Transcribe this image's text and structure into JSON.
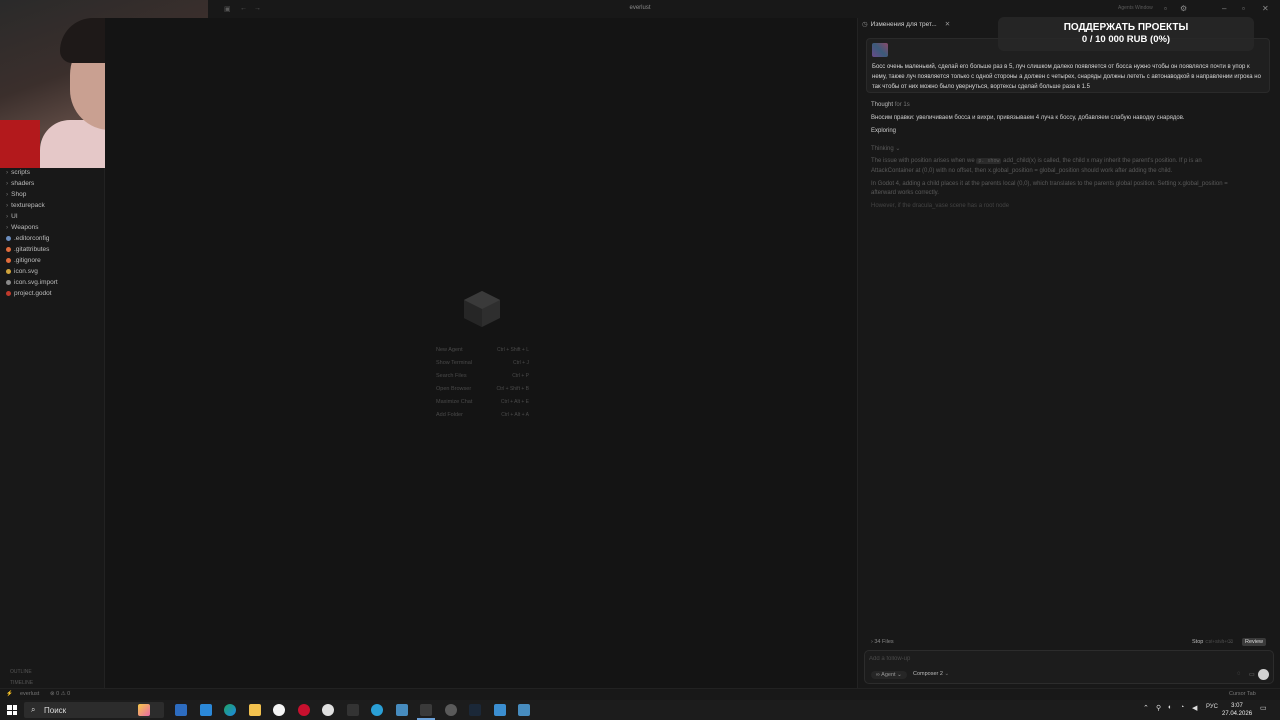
{
  "window": {
    "title": "everlust",
    "agents_window": "Agents Window"
  },
  "sidebar": {
    "items": [
      {
        "label": "scripts",
        "kind": "folder"
      },
      {
        "label": "shaders",
        "kind": "folder"
      },
      {
        "label": "Shop",
        "kind": "folder"
      },
      {
        "label": "texturepack",
        "kind": "folder"
      },
      {
        "label": "UI",
        "kind": "folder"
      },
      {
        "label": "Weapons",
        "kind": "folder"
      },
      {
        "label": ".editorconfig",
        "kind": "file",
        "color": "#6c8ebf"
      },
      {
        "label": ".gitattributes",
        "kind": "file",
        "color": "#e06c3c"
      },
      {
        "label": ".gitignore",
        "kind": "file",
        "color": "#e06c3c"
      },
      {
        "label": "icon.svg",
        "kind": "file",
        "color": "#d1a43c"
      },
      {
        "label": "icon.svg.import",
        "kind": "file",
        "color": "#8a8a8a"
      },
      {
        "label": "project.godot",
        "kind": "file",
        "color": "#c0392b"
      }
    ],
    "outline_label": "OUTLINE",
    "timeline_label": "TIMELINE"
  },
  "editor": {
    "shortcuts": [
      {
        "label": "New Agent",
        "keys": "Ctrl + Shift + L"
      },
      {
        "label": "Show Terminal",
        "keys": "Ctrl + J"
      },
      {
        "label": "Search Files",
        "keys": "Ctrl + P"
      },
      {
        "label": "Open Browser",
        "keys": "Ctrl + Shift + B"
      },
      {
        "label": "Maximize Chat",
        "keys": "Ctrl + Alt + E"
      },
      {
        "label": "Add Folder",
        "keys": "Ctrl + Alt + A"
      }
    ]
  },
  "chat": {
    "tab_title": "Изменения для трет...",
    "donation": {
      "line1": "ПОДДЕРЖАТЬ ПРОЕКТЫ",
      "line2": "0 / 10 000 RUB (0%)"
    },
    "user_message": "Босс очень маленький, сделай его больше раз в 5, луч слишком далеко появляется от босса нужно чтобы он появлялся почти в упор к нему, также луч появляется только с одной стороны а должен с четырех, снаряды должны лететь с автонаводкой в направлении игрока но так чтобы от них можно было увернуться, вортексы сделай больше раза в 1.5",
    "thought_label": "Thought",
    "thought_time": "for 1s",
    "summary": "Вносим правки: увеличиваем босса и вихри, привязываем 4 луча к боссу, добавляем слабую наводку снарядов.",
    "exploring": "Exploring",
    "thinking": "Thinking",
    "thinking_text_1a": "The issue with position arises when we",
    "thinking_code": "p. show",
    "thinking_text_1b": "add_child(x)  is called, the child x may inherit the parent's position. If p is an",
    "thinking_text_2": "AttackContainer at (0,0) with no offset, then x.global_position = global_position should work after adding the child.",
    "thinking_text_3": "In Godot 4, adding a child places it at the parents local (0,0), which translates to the parents global position. Setting x.global_position =",
    "thinking_text_4": "afterward works correctly.",
    "thinking_text_5": "However, if the dracula_vase scene has a root node",
    "files_count": "34 Files",
    "stop_label": "Stop",
    "stop_shortcut": "Ctrl+Shift+⌫",
    "review_label": "Review",
    "input_placeholder": "Add a follow-up",
    "mode": "Agent",
    "model": "Composer 2"
  },
  "statusbar": {
    "branch": "everlust",
    "problems": "⊗ 0  ⚠ 0",
    "cursor_tab": "Cursor Tab"
  },
  "taskbar": {
    "search_placeholder": "Поиск",
    "language": "РУС",
    "time": "3:07",
    "date": "27.04.2026"
  }
}
